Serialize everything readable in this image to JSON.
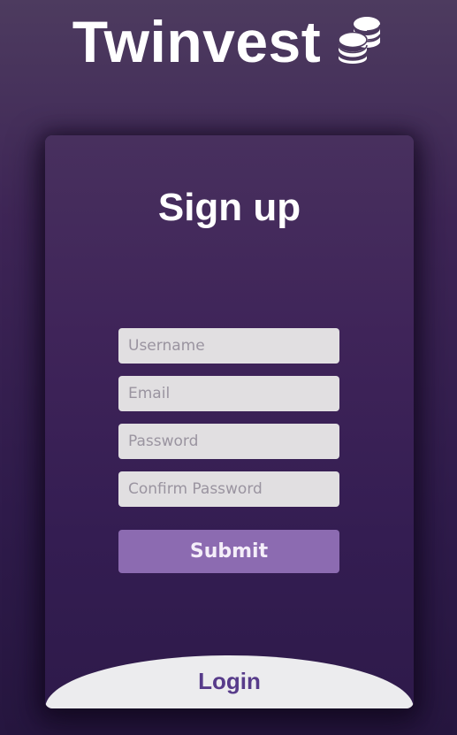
{
  "brand": {
    "name": "Twinvest",
    "icon": "coins-icon"
  },
  "signup": {
    "title": "Sign up",
    "fields": {
      "username": {
        "placeholder": "Username",
        "value": ""
      },
      "email": {
        "placeholder": "Email",
        "value": ""
      },
      "password": {
        "placeholder": "Password",
        "value": ""
      },
      "confirm_password": {
        "placeholder": "Confirm Password",
        "value": ""
      }
    },
    "submit_label": "Submit"
  },
  "login": {
    "label": "Login"
  },
  "colors": {
    "background": "#3a2352",
    "card": "#3f2459",
    "input": "#e1dfe1",
    "button": "#8c6bb1",
    "login_tab": "#ececee",
    "login_text": "#573b8a"
  }
}
